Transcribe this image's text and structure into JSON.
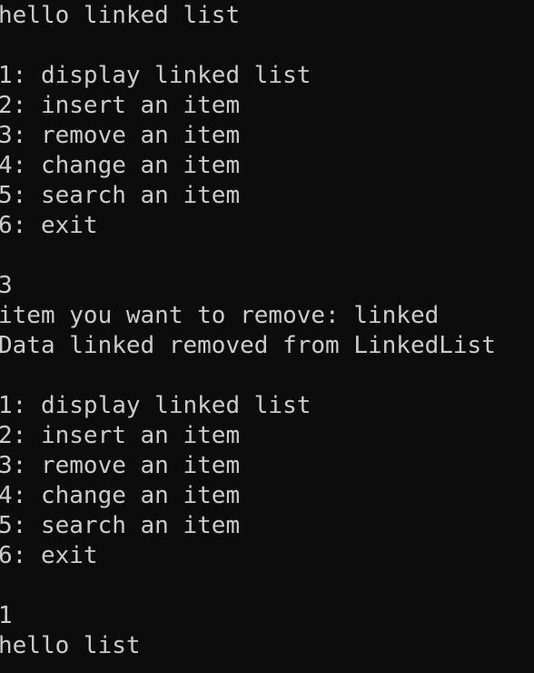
{
  "console": {
    "background": "#0c0c0c",
    "foreground": "#cccccc",
    "greeting": "hello linked list",
    "menu_1": {
      "display": "1: display linked list",
      "insert": "2: insert an item",
      "remove": "3: remove an item",
      "change": "4: change an item",
      "search": "5: search an item",
      "exit": "6: exit"
    },
    "input_1": "3",
    "prompt_remove": "item you want to remove: linked",
    "result_remove": "Data linked removed from LinkedList",
    "menu_2": {
      "display": "1: display linked list",
      "insert": "2: insert an item",
      "remove": "3: remove an item",
      "change": "4: change an item",
      "search": "5: search an item",
      "exit": "6: exit"
    },
    "input_2": "1",
    "display_output": "hello list"
  }
}
